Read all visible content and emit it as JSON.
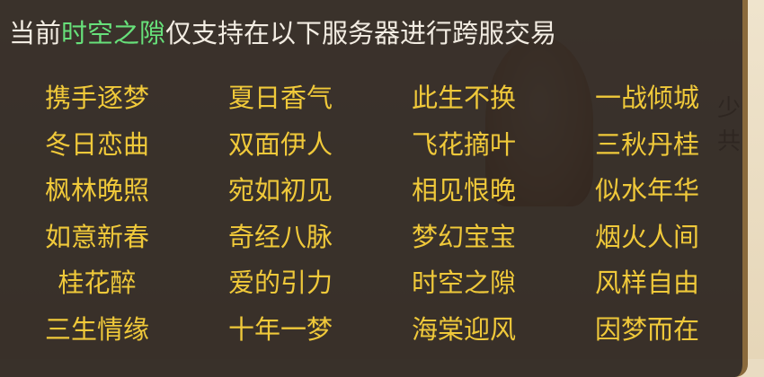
{
  "header": {
    "prefix": "当前",
    "server": "时空之隙",
    "suffix": "仅支持在以下服务器进行跨服交易"
  },
  "servers": [
    "携手逐梦",
    "夏日香气",
    "此生不换",
    "一战倾城",
    "冬日恋曲",
    "双面伊人",
    "飞花摘叶",
    "三秋丹桂",
    "枫林晚照",
    "宛如初见",
    "相见恨晚",
    "似水年华",
    "如意新春",
    "奇经八脉",
    "梦幻宝宝",
    "烟火人间",
    "桂花醉",
    "爱的引力",
    "时空之隙",
    "风样自由",
    "三生情缘",
    "十年一梦",
    "海棠迎风",
    "因梦而在"
  ],
  "background": {
    "side_text": "少共"
  },
  "colors": {
    "header_text": "#f2ece2",
    "highlight": "#67e07a",
    "server_text": "#f0c93a",
    "panel_bg": "#261e1a"
  }
}
